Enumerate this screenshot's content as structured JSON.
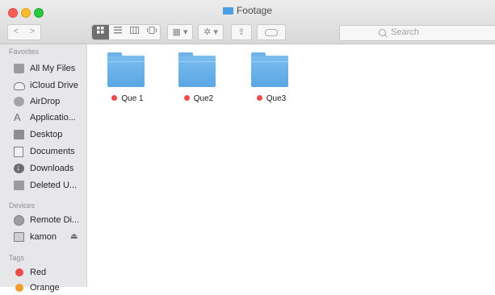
{
  "window": {
    "title": "Footage"
  },
  "toolbar": {
    "back_label": "<",
    "forward_label": ">",
    "view_icons": [
      "icon-view-icon",
      "list-view-icon",
      "column-view-icon",
      "coverflow-view-icon"
    ],
    "arrange_label": "▦ ▾",
    "action_label": "✲ ▾",
    "share_label": "⇪",
    "search_placeholder": "Search"
  },
  "sidebar": {
    "favorites_header": "Favorites",
    "favorites": [
      {
        "label": "All My Files",
        "icon": "all-files-icon"
      },
      {
        "label": "iCloud Drive",
        "icon": "cloud-icon"
      },
      {
        "label": "AirDrop",
        "icon": "airdrop-icon"
      },
      {
        "label": "Applicatio...",
        "icon": "applications-icon"
      },
      {
        "label": "Desktop",
        "icon": "desktop-icon"
      },
      {
        "label": "Documents",
        "icon": "documents-icon"
      },
      {
        "label": "Downloads",
        "icon": "downloads-icon"
      },
      {
        "label": "Deleted U...",
        "icon": "folder-icon"
      }
    ],
    "devices_header": "Devices",
    "devices": [
      {
        "label": "Remote Di...",
        "icon": "disc-icon"
      },
      {
        "label": "kamon",
        "icon": "hard-drive-icon",
        "eject": "⏏"
      }
    ],
    "tags_header": "Tags",
    "tags": [
      {
        "label": "Red",
        "color": "#ee4b4b"
      },
      {
        "label": "Orange",
        "color": "#f39a2c"
      }
    ]
  },
  "content": {
    "files": [
      {
        "name": "Que 1",
        "tag_color": "#ef4b4b"
      },
      {
        "name": "Que2",
        "tag_color": "#ef4b4b"
      },
      {
        "name": "Que3",
        "tag_color": "#ef4b4b"
      }
    ]
  },
  "colors": {
    "folder_blue": "#5aa6e3",
    "sidebar_bg": "#e7e6e8",
    "toolbar_bg": "#dcdcdc"
  }
}
